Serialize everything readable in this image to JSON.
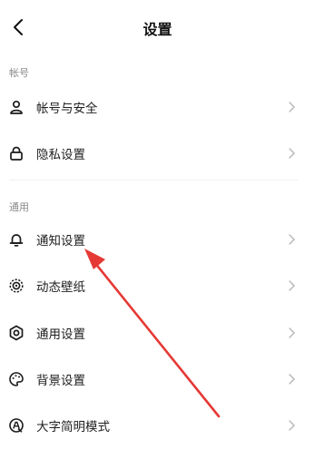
{
  "header": {
    "title": "设置",
    "back_icon": "chevron-left-icon"
  },
  "sections": [
    {
      "label": "帐号",
      "items": [
        {
          "label": "帐号与安全",
          "icon": "person-icon"
        },
        {
          "label": "隐私设置",
          "icon": "lock-icon"
        }
      ]
    },
    {
      "label": "通用",
      "items": [
        {
          "label": "通知设置",
          "icon": "bell-icon"
        },
        {
          "label": "动态壁纸",
          "icon": "wallpaper-icon"
        },
        {
          "label": "通用设置",
          "icon": "gear-icon"
        },
        {
          "label": "背景设置",
          "icon": "palette-icon"
        },
        {
          "label": "大字简明模式",
          "icon": "large-text-icon"
        }
      ]
    }
  ],
  "colors": {
    "annotation_arrow": "#e53935",
    "chevron": "#b5b5b5",
    "section_label": "#8a8a8a"
  }
}
